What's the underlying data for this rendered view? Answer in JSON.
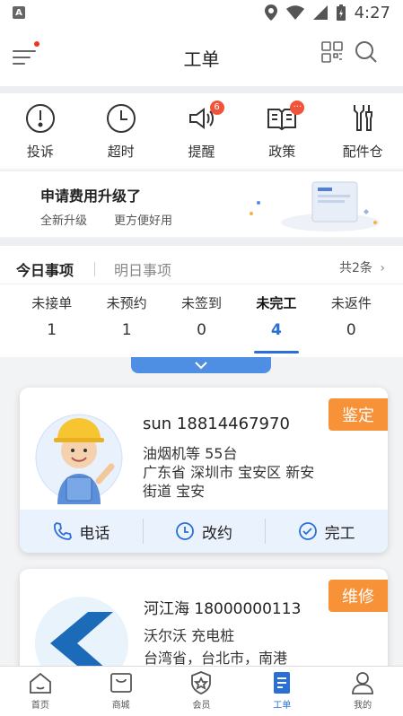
{
  "status_bar": {
    "app_icon": "A",
    "time": "4:27"
  },
  "header": {
    "title": "工单"
  },
  "quick_actions": [
    {
      "label": "投诉",
      "icon": "alert-icon"
    },
    {
      "label": "超时",
      "icon": "clock-icon"
    },
    {
      "label": "提醒",
      "icon": "speaker-icon",
      "badge": "6"
    },
    {
      "label": "政策",
      "icon": "book-icon",
      "badge": "···"
    },
    {
      "label": "配件仓",
      "icon": "tools-icon"
    }
  ],
  "promo": {
    "title": "申请费用升级了",
    "sub1": "全新升级",
    "sub2": "更方便好用"
  },
  "tabs": {
    "today": "今日事项",
    "tomorrow": "明日事项",
    "total": "共2条"
  },
  "stats": [
    {
      "label": "未接单",
      "value": "1"
    },
    {
      "label": "未预约",
      "value": "1"
    },
    {
      "label": "未签到",
      "value": "0"
    },
    {
      "label": "未完工",
      "value": "4",
      "active": true
    },
    {
      "label": "未返件",
      "value": "0"
    }
  ],
  "orders": [
    {
      "tag": "鉴定",
      "contact": "sun  18814467970",
      "equipment": "油烟机等   55台",
      "address": "广东省 深圳市 宝安区 新安街道 宝安",
      "actions": [
        "电话",
        "改约",
        "完工"
      ]
    },
    {
      "tag": "维修",
      "contact": "河江海 18000000113",
      "equipment": "沃尔沃 充电桩",
      "address": "台湾省，台北市，南港"
    }
  ],
  "bottom_nav": [
    {
      "label": "首页",
      "icon": "home-icon"
    },
    {
      "label": "商城",
      "icon": "shop-icon"
    },
    {
      "label": "会员",
      "icon": "member-icon"
    },
    {
      "label": "工单",
      "icon": "workorder-icon",
      "active": true
    },
    {
      "label": "我的",
      "icon": "profile-icon"
    }
  ],
  "colors": {
    "accent": "#2a6fd6",
    "tag": "#f79238",
    "badge": "#f2533b"
  }
}
